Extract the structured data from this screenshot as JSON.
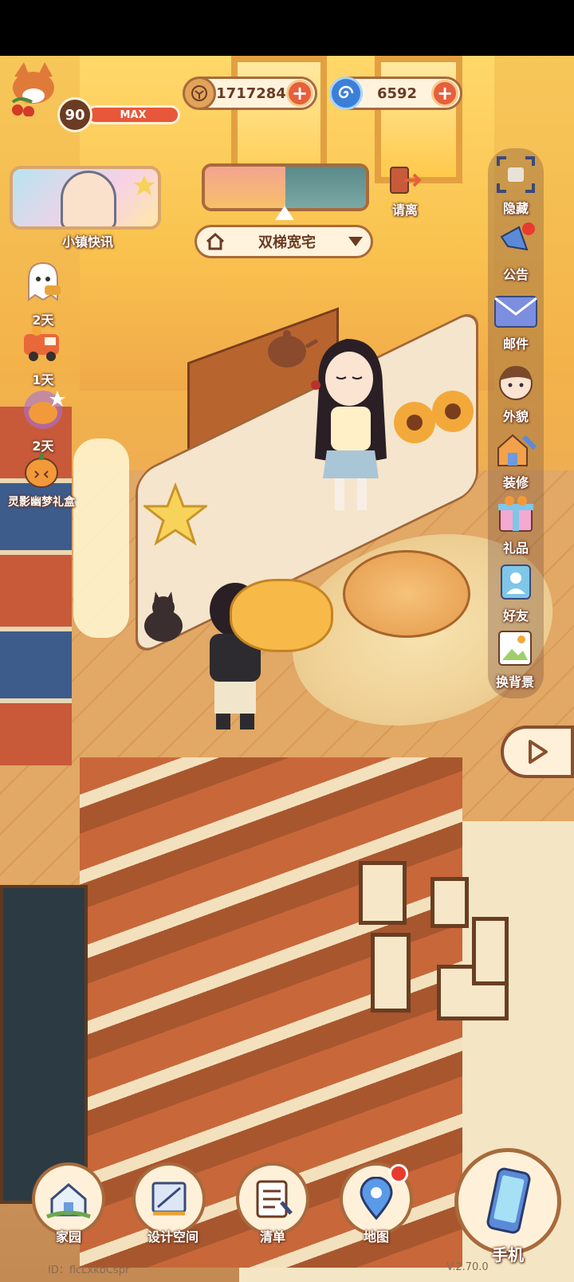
{
  "player": {
    "level": "90",
    "level_status": "MAX"
  },
  "currency": {
    "coins": "1717284",
    "gems": "6592",
    "plus": "+"
  },
  "news": {
    "label": "小镇快讯"
  },
  "weather_selector": {
    "house_name": "双梯宽宅"
  },
  "leave_button": {
    "label": "请离"
  },
  "left_events": [
    {
      "label": "2天",
      "icon": "ghost-icon"
    },
    {
      "label": "1天",
      "icon": "truck-icon"
    },
    {
      "label": "2天",
      "icon": "pumpkin-sparkle-icon"
    },
    {
      "label": "灵影幽梦礼盒",
      "icon": "pumpkin-icon"
    }
  ],
  "right_menu": [
    {
      "label": "隐藏",
      "icon": "hide-icon"
    },
    {
      "label": "公告",
      "icon": "megaphone-icon"
    },
    {
      "label": "邮件",
      "icon": "mail-icon"
    },
    {
      "label": "外貌",
      "icon": "face-icon"
    },
    {
      "label": "装修",
      "icon": "house-wrench-icon"
    },
    {
      "label": "礼品",
      "icon": "gift-icon"
    },
    {
      "label": "好友",
      "icon": "friend-icon"
    },
    {
      "label": "换背景",
      "icon": "background-icon"
    }
  ],
  "bottom_nav": [
    {
      "label": "家园",
      "icon": "home-icon"
    },
    {
      "label": "设计空间",
      "icon": "design-icon"
    },
    {
      "label": "清单",
      "icon": "list-icon"
    },
    {
      "label": "地图",
      "icon": "map-pin-icon"
    },
    {
      "label": "手机",
      "icon": "phone-icon"
    }
  ],
  "footer": {
    "id_text": "ID：flcLxkbCspr",
    "version": "V.2.70.0"
  },
  "colors": {
    "accent_red": "#e6603c",
    "frame_brown": "#a86a3c",
    "panel_cream": "#fff3de",
    "text_brown": "#6b3b24"
  }
}
